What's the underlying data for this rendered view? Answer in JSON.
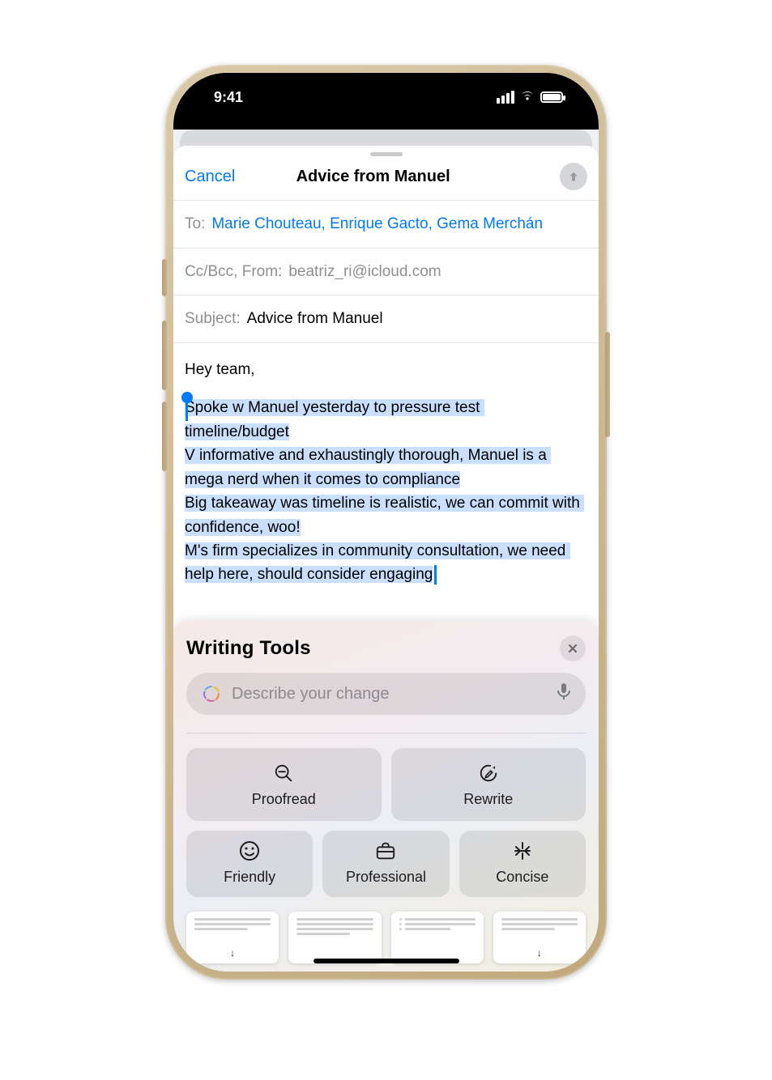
{
  "statusbar": {
    "time": "9:41"
  },
  "compose": {
    "cancel": "Cancel",
    "title": "Advice from Manuel",
    "to_label": "To:",
    "to_recipients": "Marie Chouteau, Enrique Gacto, Gema Merchán",
    "cc_label": "Cc/Bcc, From:",
    "from_email": "beatriz_ri@icloud.com",
    "subject_label": "Subject:",
    "subject_value": "Advice from Manuel",
    "body_greeting": "Hey team,",
    "body_selected": "Spoke w Manuel yesterday to pressure test timeline/budget\nV informative and exhaustingly thorough, Manuel is a mega nerd when it comes to compliance\nBig takeaway was timeline is realistic, we can commit with confidence, woo!\nM's firm specializes in community consultation, we need help here, should consider engaging"
  },
  "writing_tools": {
    "title": "Writing Tools",
    "input_placeholder": "Describe your change",
    "proofread": "Proofread",
    "rewrite": "Rewrite",
    "friendly": "Friendly",
    "professional": "Professional",
    "concise": "Concise"
  }
}
